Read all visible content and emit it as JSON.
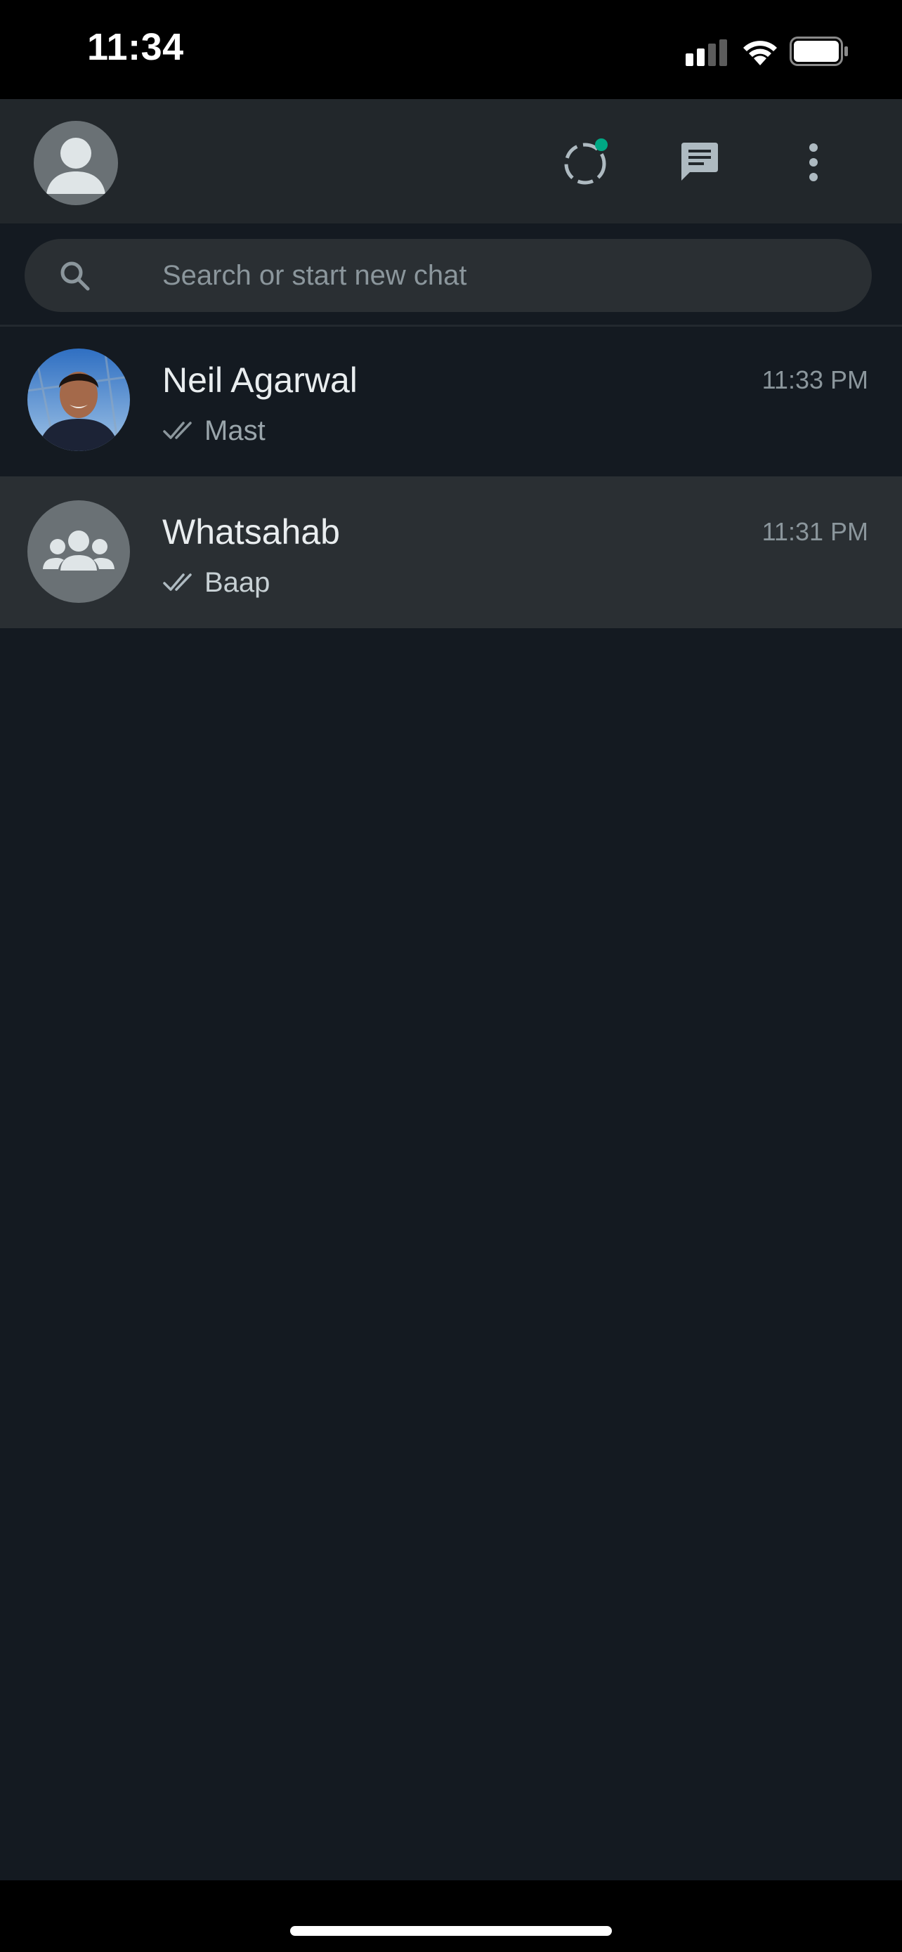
{
  "status_bar": {
    "time": "11:34",
    "icons": [
      "signal-icon",
      "wifi-icon",
      "battery-icon"
    ]
  },
  "header": {
    "icons": [
      "profile-avatar",
      "status-icon",
      "new-chat-icon",
      "more-options-icon"
    ],
    "status_dot_color": "#00a884"
  },
  "search": {
    "placeholder": "Search or start new chat",
    "value": ""
  },
  "chats": [
    {
      "name": "Neil Agarwal",
      "time": "11:33 PM",
      "last_message": "Mast",
      "receipt": "double-check-icon",
      "avatar": "photo",
      "selected": false
    },
    {
      "name": "Whatsahab",
      "time": "11:31 PM",
      "last_message": "Baap",
      "receipt": "double-check-icon",
      "avatar": "group-icon",
      "selected": true
    }
  ],
  "colors": {
    "background": "#141a21",
    "header": "#22272b",
    "selected_row": "#2a2f33",
    "accent": "#00a884"
  }
}
